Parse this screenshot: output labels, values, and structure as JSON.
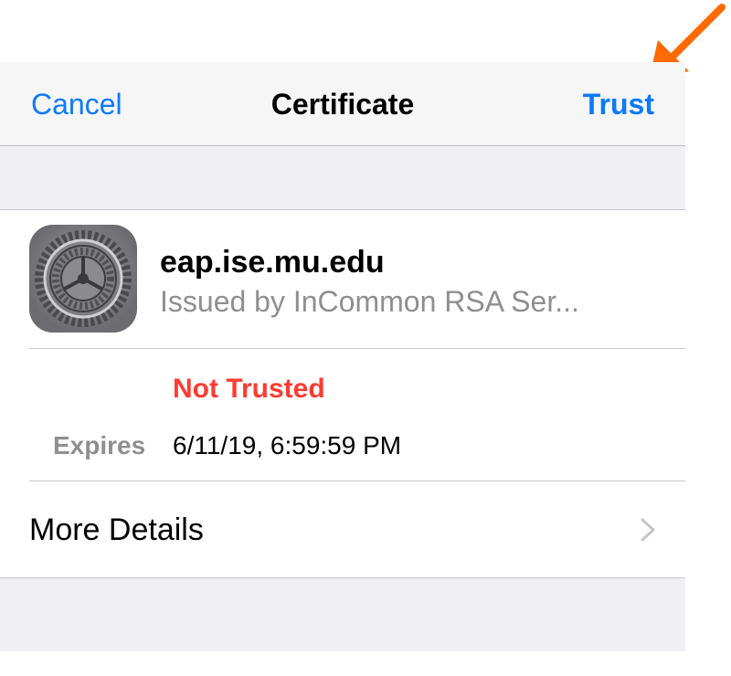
{
  "navbar": {
    "cancel_label": "Cancel",
    "title": "Certificate",
    "trust_label": "Trust"
  },
  "certificate": {
    "icon": "settings-gear-icon",
    "name": "eap.ise.mu.edu",
    "issuer": "Issued by InCommon RSA Ser..."
  },
  "status": {
    "text": "Not Trusted",
    "color": "#ff3b30"
  },
  "expires": {
    "label": "Expires",
    "value": "6/11/19, 6:59:59 PM"
  },
  "more_details": {
    "label": "More Details",
    "icon": "chevron-right-icon"
  },
  "colors": {
    "accent": "#0a7aff",
    "annotation_arrow": "#ff6a00"
  }
}
